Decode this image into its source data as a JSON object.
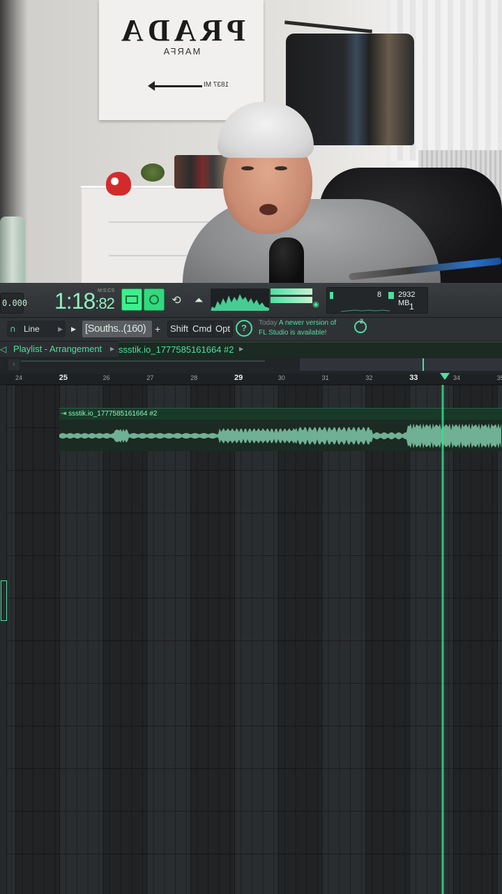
{
  "webcam": {
    "poster_brand": "PRADA",
    "poster_sub": "MARFA",
    "poster_mi": "1837 MI"
  },
  "toolbar": {
    "tempo": "0.000",
    "time_format": "M:S:CS",
    "time_main": "1:18",
    "time_cs": ":82",
    "cpu_value": "8",
    "memory": "2932 MB",
    "poly": "1"
  },
  "toolbar2": {
    "snap_label": "Line",
    "pattern_name": "[Souths..(160)",
    "shift_label": "Shift",
    "cmd_label": "Cmd",
    "opt_label": "Opt",
    "news_today": "Today",
    "news_text_1": "A newer version of",
    "news_text_2": "FL Studio is available!",
    "globe_badge": "2"
  },
  "playlist": {
    "title": "Playlist - Arrangement",
    "clip_name": "ssstik.io_1777585161664 #2",
    "clip_label": "ssstik.io_1777585161664 #2",
    "ruler": [
      "24",
      "25",
      "26",
      "27",
      "28",
      "29",
      "30",
      "31",
      "32",
      "33",
      "34",
      "35"
    ],
    "ruler_major": [
      "25",
      "29",
      "33"
    ]
  },
  "colors": {
    "accent": "#4be0a0",
    "background": "#2a2d30"
  }
}
